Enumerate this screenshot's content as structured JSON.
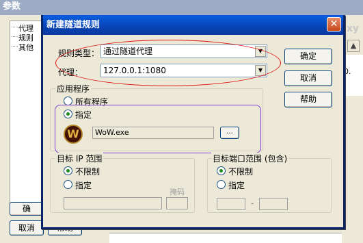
{
  "background": {
    "title": "参数",
    "tree": [
      "代理",
      "规则",
      "其他"
    ],
    "right_text": "xy",
    "list_value": "0.",
    "buttons": [
      "确",
      "取消",
      "帮助"
    ]
  },
  "dialog": {
    "title": "新建隧道规则",
    "rule_type_label": "规则类型：",
    "rule_type_value": "通过隧道代理",
    "proxy_label": "代理：",
    "proxy_value": "127.0.0.1:1080",
    "ok_label": "确定",
    "cancel_label": "取消",
    "help_label": "帮助",
    "app_group_label": "应用程序",
    "all_programs_label": "所有程序",
    "specify_label": "指定",
    "app_path": "WoW.exe",
    "browse_label": "...",
    "target_ip_label": "目标 IP 范围",
    "ip_unlimited_label": "不限制",
    "ip_specify_label": "指定",
    "mask_label": "掩码",
    "target_port_label": "目标端口范围 (包含)",
    "port_unlimited_label": "不限制",
    "port_specify_label": "指定",
    "port_dash": "-"
  },
  "colors": {
    "title_bar": "#0a5fe0",
    "annotation_red": "#e01010",
    "annotation_purple": "#7a3fcf"
  }
}
